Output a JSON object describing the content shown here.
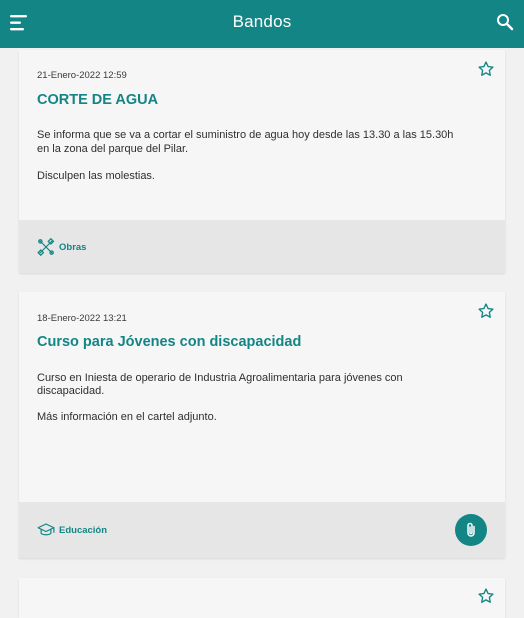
{
  "header": {
    "title": "Bandos",
    "color": "#138585"
  },
  "icons": {
    "menu": "menu-icon",
    "search": "search-icon",
    "favorite": "star-outline-icon",
    "attachment": "paperclip-icon"
  },
  "bandos": [
    {
      "date": "21-Enero-2022 12:59",
      "title": "CORTE DE AGUA",
      "paragraph1_line1": "Se informa que se va a cortar el suministro de agua hoy desde las 13.30 a las 15.30h",
      "paragraph1_line2": "en la zona del parque del Pilar.",
      "paragraph2": "Disculpen las molestias.",
      "category": "Obras",
      "category_icon": "tools-icon"
    },
    {
      "date": "18-Enero-2022 13:21",
      "title": "Curso para Jóvenes con discapacidad",
      "paragraph1_line1": "Curso en Iniesta de operario de Industria Agroalimentaria para jóvenes con",
      "paragraph1_line2": "discapacidad.",
      "paragraph2": "Más información en el cartel adjunto.",
      "category": "Educación",
      "category_icon": "graduation-cap-icon",
      "has_attachment": true
    }
  ]
}
